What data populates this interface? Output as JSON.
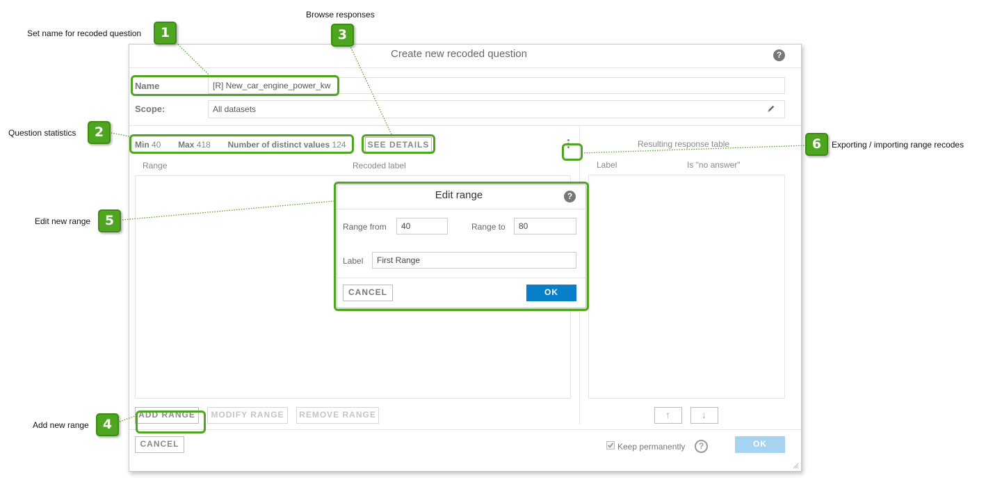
{
  "callouts": [
    {
      "num": "1",
      "text": "Set name for recoded question"
    },
    {
      "num": "2",
      "text": "Question statistics"
    },
    {
      "num": "3",
      "text": "Browse responses"
    },
    {
      "num": "4",
      "text": "Add new range"
    },
    {
      "num": "5",
      "text": "Edit new range"
    },
    {
      "num": "6",
      "text": "Exporting / importing range recodes"
    }
  ],
  "dialog": {
    "title": "Create new recoded question",
    "help_icon": "?",
    "name_label": "Name",
    "name_value": "[R] New_car_engine_power_kw",
    "scope_label": "Scope:",
    "scope_value": "All datasets",
    "edit_icon": "pencil-icon"
  },
  "stats": {
    "min_label": "Min",
    "min_value": "40",
    "max_label": "Max",
    "max_value": "418",
    "distinct_label": "Number of distinct values",
    "distinct_value": "124",
    "see_details": "SEE DETAILS"
  },
  "ranges": {
    "col_range": "Range",
    "col_recoded_label": "Recoded label",
    "add_range": "ADD RANGE",
    "modify_range": "MODIFY RANGE",
    "remove_range": "REMOVE RANGE"
  },
  "result_table": {
    "title": "Resulting response table",
    "col_label": "Label",
    "col_no_answer": "Is \"no answer\"",
    "up_icon": "↑",
    "down_icon": "↓"
  },
  "footer": {
    "cancel": "CANCEL",
    "keep_permanently": "Keep permanently",
    "keep_checked": true,
    "ok": "OK"
  },
  "edit_range": {
    "title": "Edit range",
    "range_from_label": "Range from",
    "range_from_value": "40",
    "range_to_label": "Range to",
    "range_to_value": "80",
    "label_label": "Label",
    "label_value": "First Range",
    "cancel": "CANCEL",
    "ok": "OK"
  },
  "colors": {
    "callout_green": "#4ea51f",
    "primary_blue": "#0a7fc9",
    "disabled_blue": "#a6d3ef"
  }
}
